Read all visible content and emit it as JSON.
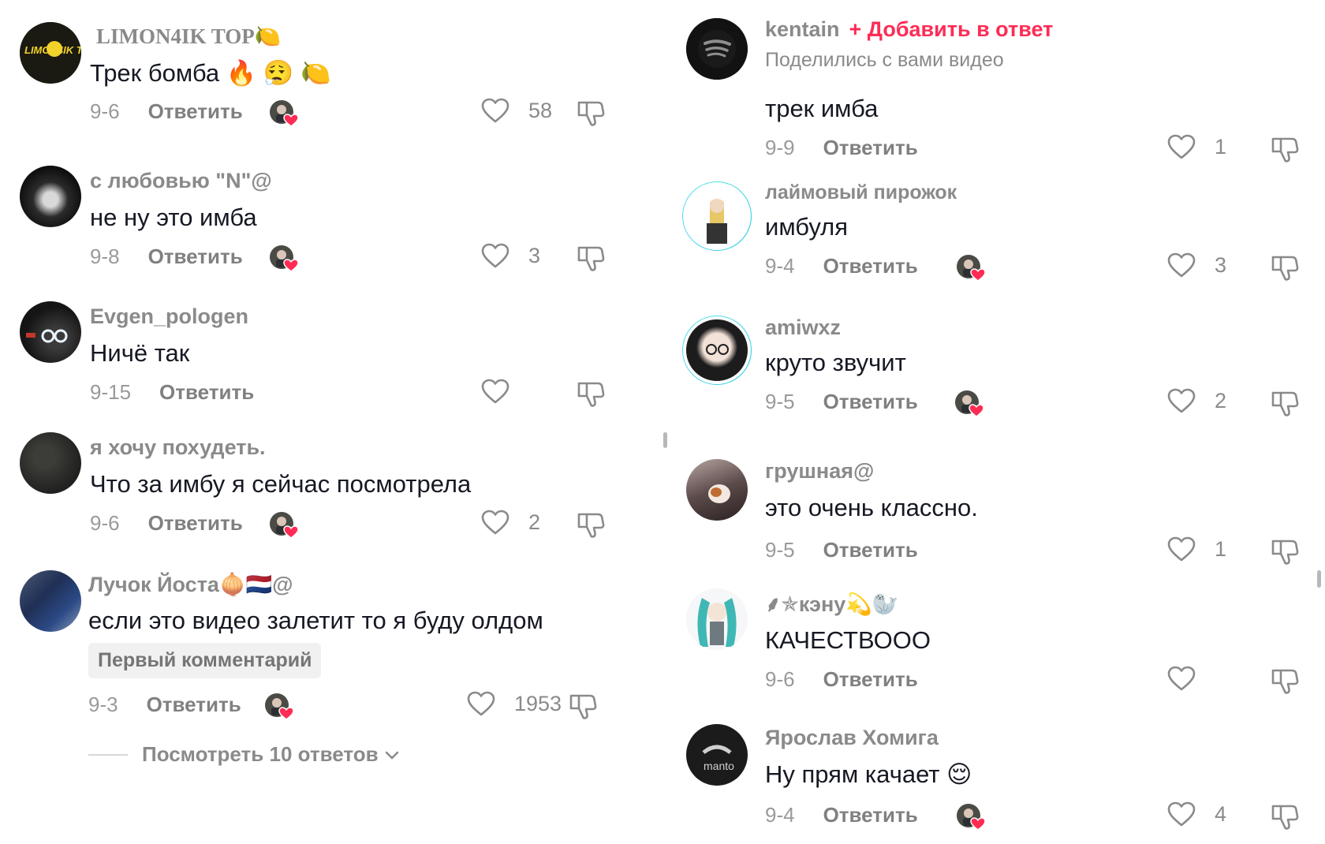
{
  "colors": {
    "accent": "#fe2c55",
    "muted": "#8a8a8a",
    "text": "#161823"
  },
  "left": [
    {
      "user": "LIMON4IK TOP🍋",
      "text": "Трек бомба 🔥 😮‍💨 🍋",
      "date": "9-6",
      "reply": "Ответить",
      "likes": "58",
      "creator_liked": true
    },
    {
      "user": "с любовью \"N\"@",
      "text": "не ну это имба",
      "date": "9-8",
      "reply": "Ответить",
      "likes": "3",
      "creator_liked": true
    },
    {
      "user": "Evgen_pologen",
      "text": "Ничё так",
      "date": "9-15",
      "reply": "Ответить",
      "likes": "",
      "creator_liked": false
    },
    {
      "user": "я хочу похудеть.",
      "text": "Что за имбу я сейчас посмотрела",
      "date": "9-6",
      "reply": "Ответить",
      "likes": "2",
      "creator_liked": true
    },
    {
      "user": "Лучок Йоста🧅🇳🇱@",
      "text": "если это видео залетит то я буду олдом",
      "badge": "Первый комментарий",
      "date": "9-3",
      "reply": "Ответить",
      "likes": "1953",
      "creator_liked": true,
      "view_more": "Посмотреть 10 ответов"
    }
  ],
  "right": [
    {
      "user": "kentain",
      "add": "+ Добавить в ответ",
      "sub": "Поделились с вами видео",
      "text": "трек имба",
      "date": "9-9",
      "reply": "Ответить",
      "likes": "1",
      "creator_liked": false
    },
    {
      "user": "лаймовый пирожок",
      "text": "имбуля",
      "date": "9-4",
      "reply": "Ответить",
      "likes": "3",
      "creator_liked": true
    },
    {
      "user": "amiwxz",
      "text": "круто звучит",
      "date": "9-5",
      "reply": "Ответить",
      "likes": "2",
      "creator_liked": true
    },
    {
      "user": "грушная@",
      "text": "это очень классно.",
      "date": "9-5",
      "reply": "Ответить",
      "likes": "1",
      "creator_liked": false
    },
    {
      "user": "⸙✯кэну💫🦭",
      "text": "КАЧЕСТВООО",
      "date": "9-6",
      "reply": "Ответить",
      "likes": "",
      "creator_liked": false
    },
    {
      "user": "Ярослав Хомига",
      "text": "Ну прям качает 😌",
      "date": "9-4",
      "reply": "Ответить",
      "likes": "4",
      "creator_liked": true
    }
  ],
  "avatar_labels": {
    "limon": "LIMON4IK TOP",
    "manto": "manto"
  }
}
